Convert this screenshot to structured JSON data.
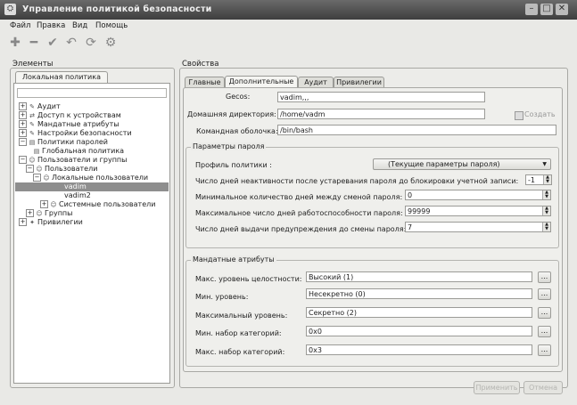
{
  "window": {
    "title": "Управление политикой безопасности"
  },
  "menu": [
    "Файл",
    "Правка",
    "Вид",
    "Помощь"
  ],
  "toolbar": {
    "icons": [
      "plus-icon",
      "minus-icon",
      "check-icon",
      "undo-icon",
      "refresh-icon",
      "settings-icon"
    ]
  },
  "elements_panel": {
    "label": "Элементы",
    "tab": "Локальная политика",
    "tree": [
      {
        "label": "Аудит",
        "icon": "audit-icon"
      },
      {
        "label": "Доступ к устройствам",
        "icon": "device-icon"
      },
      {
        "label": "Мандатные атрибуты",
        "icon": "mandatory-icon"
      },
      {
        "label": "Настройки безопасности",
        "icon": "security-settings-icon"
      },
      {
        "label": "Политики паролей",
        "icon": "password-policy-icon"
      },
      {
        "label": "Глобальная политика",
        "icon": "policy-icon"
      },
      {
        "label": "Пользователи и группы",
        "icon": "users-groups-icon"
      },
      {
        "label": "Пользователи",
        "icon": "users-icon"
      },
      {
        "label": "Локальные пользователи",
        "icon": "local-users-icon"
      },
      {
        "label": "vadim",
        "icon": "user-icon"
      },
      {
        "label": "vadim2",
        "icon": "user-icon"
      },
      {
        "label": "Системные пользователи",
        "icon": "system-users-icon"
      },
      {
        "label": "Группы",
        "icon": "groups-icon"
      },
      {
        "label": "Привилегии",
        "icon": "privileges-icon"
      }
    ]
  },
  "properties_panel": {
    "label": "Свойства",
    "tabs": [
      "Главные",
      "Дополнительные",
      "Аудит",
      "Привилегии"
    ],
    "gecos": {
      "label": "Gecos:",
      "value": "vadim,,,"
    },
    "home_dir": {
      "label": "Домашняя директория:",
      "value": "/home/vadm",
      "checkbox_label": "Создать"
    },
    "shell": {
      "label": "Командная оболочка:",
      "value": "/bin/bash"
    },
    "password_params": {
      "legend": "Параметры пароля",
      "profile": {
        "label": "Профиль политики :",
        "value": "(Текущие параметры пароля)"
      },
      "inactive_days": {
        "label": "Число дней неактивности после устаревания пароля до блокировки учетной записи:",
        "value": "-1"
      },
      "min_days": {
        "label": "Минимальное количество дней между сменой пароля:",
        "value": "0"
      },
      "max_days": {
        "label": "Максимальное число дней работоспособности пароля:",
        "value": "99999"
      },
      "warn_days": {
        "label": "Число дней выдачи предупреждения до смены пароля:",
        "value": "7"
      }
    },
    "mandatory_attrs": {
      "legend": "Мандатные атрибуты",
      "max_integrity": {
        "label": "Макс. уровень целостности:",
        "value": "Высокий (1)"
      },
      "min_level": {
        "label": "Мин. уровень:",
        "value": "Несекретно (0)"
      },
      "max_level": {
        "label": "Максимальный уровень:",
        "value": "Секретно (2)"
      },
      "min_categories": {
        "label": "Мин. набор категорий:",
        "value": "0x0"
      },
      "max_categories": {
        "label": "Макс. набор категорий:",
        "value": "0x3"
      },
      "browse_label": "..."
    },
    "apply_label": "Применить",
    "cancel_label": "Отмена"
  }
}
